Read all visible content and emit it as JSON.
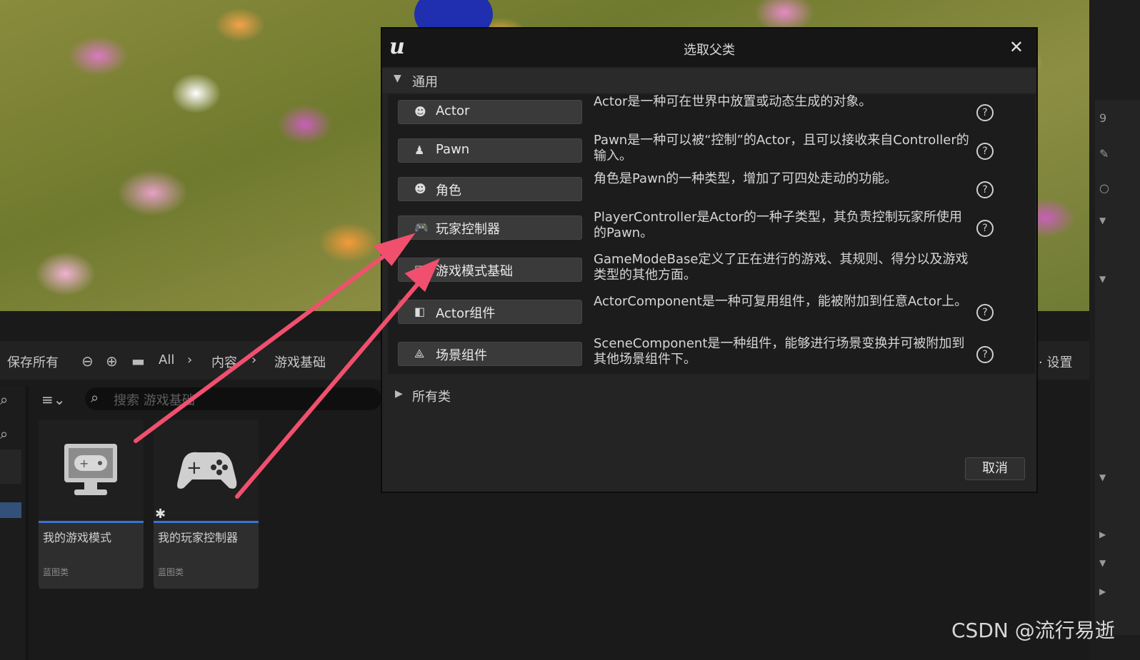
{
  "dialog": {
    "title": "选取父类",
    "section_common": "通用",
    "section_all": "所有类",
    "cancel_label": "取消",
    "classes": [
      {
        "name": "Actor",
        "icon": "actor-icon",
        "desc": "Actor是一种可在世界中放置或动态生成的对象。",
        "help": true
      },
      {
        "name": "Pawn",
        "icon": "pawn-icon",
        "desc": "Pawn是一种可以被“控制”的Actor，且可以接收来自Controller的输入。",
        "help": true
      },
      {
        "name": "角色",
        "icon": "character-icon",
        "desc": "角色是Pawn的一种类型，增加了可四处走动的功能。",
        "help": true
      },
      {
        "name": "玩家控制器",
        "icon": "gamepad-icon",
        "desc": "PlayerController是Actor的一种子类型，其负责控制玩家所使用的Pawn。",
        "help": true
      },
      {
        "name": "游戏模式基础",
        "icon": "game-mode-icon",
        "desc": "GameModeBase定义了正在进行的游戏、其规则、得分以及游戏类型的其他方面。",
        "help": false
      },
      {
        "name": "Actor组件",
        "icon": "component-icon",
        "desc": "ActorComponent是一种可复用组件，能被附加到任意Actor上。",
        "help": true
      },
      {
        "name": "场景组件",
        "icon": "scene-component-icon",
        "desc": "SceneComponent是一种组件，能够进行场景变换并可被附加到其他场景组件下。",
        "help": true
      }
    ]
  },
  "content_browser": {
    "save_all": "保存所有",
    "breadcrumb": [
      "All",
      "内容",
      "游戏基础"
    ],
    "settings": "设置",
    "search_placeholder": "搜索 游戏基础",
    "assets": [
      {
        "name": "我的游戏模式",
        "type": "蓝图类",
        "icon": "monitor-gamepad-icon"
      },
      {
        "name": "我的玩家控制器",
        "type": "蓝图类",
        "icon": "gamepad-icon"
      }
    ]
  },
  "right_panel": {
    "top_text": "9"
  },
  "watermark": "CSDN @流行易逝",
  "colors": {
    "arrow": "#f0506e",
    "accent": "#3b70d8"
  }
}
